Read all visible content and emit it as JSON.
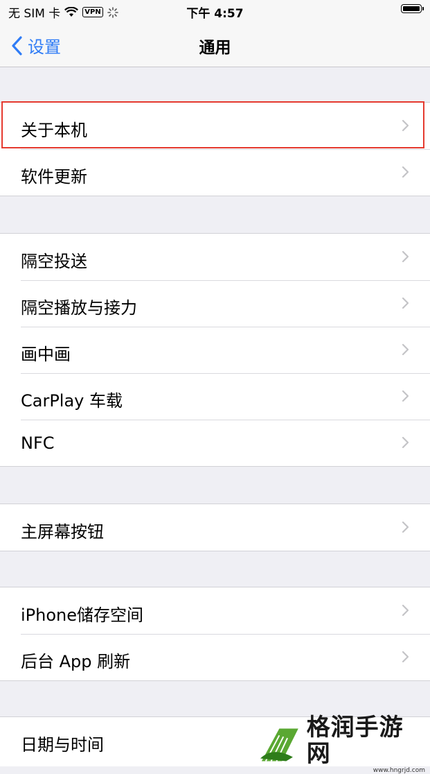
{
  "status_bar": {
    "carrier": "无 SIM 卡",
    "vpn": "VPN",
    "time": "下午 4:57"
  },
  "nav": {
    "back_label": "设置",
    "title": "通用"
  },
  "groups": [
    {
      "items": [
        "关于本机",
        "软件更新"
      ]
    },
    {
      "items": [
        "隔空投送",
        "隔空播放与接力",
        "画中画",
        "CarPlay 车载",
        "NFC"
      ]
    },
    {
      "items": [
        "主屏幕按钮"
      ]
    },
    {
      "items": [
        "iPhone储存空间",
        "后台 App 刷新"
      ]
    },
    {
      "items": [
        "日期与时间"
      ]
    }
  ],
  "highlighted_item": "关于本机",
  "colors": {
    "accent": "#2f7cf6",
    "highlight": "#e53a2f",
    "background": "#efeff4"
  },
  "watermark": {
    "title": "格润手游网",
    "url": "www.hngrjd.com"
  }
}
